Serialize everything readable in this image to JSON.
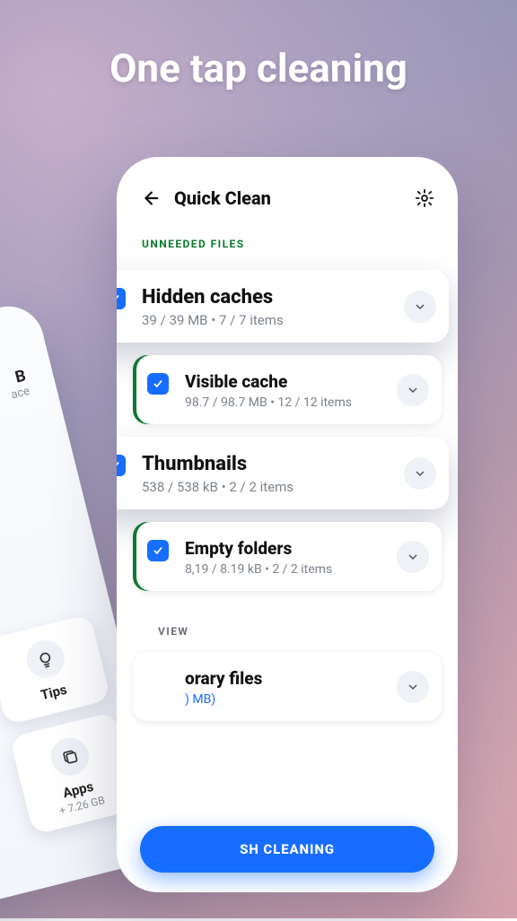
{
  "headline": "One tap cleaning",
  "phone": {
    "title": "Quick Clean",
    "section_label": "UNNEEDED FILES",
    "review_label": "VIEW",
    "items": [
      {
        "title": "Hidden caches",
        "sub": "39 / 39 MB • 7 / 7 items",
        "elevated": true
      },
      {
        "title": "Visible cache",
        "sub": "98.7 / 98.7 MB • 12 / 12 items",
        "elevated": false
      },
      {
        "title": "Thumbnails",
        "sub": "538 / 538 kB • 2 / 2 items",
        "elevated": true
      },
      {
        "title": "Empty folders",
        "sub": "8,19 / 8.19 kB • 2 / 2 items",
        "elevated": false
      }
    ],
    "temp": {
      "title": "orary files",
      "sub": ") MB)"
    },
    "cta": "SH CLEANING"
  },
  "phone2": {
    "chip_l1": "B",
    "chip_l2": "ace",
    "cards": [
      {
        "title": "Tips",
        "sub": ""
      },
      {
        "title": "Apps",
        "sub": "+ 7.26 GB"
      }
    ]
  }
}
